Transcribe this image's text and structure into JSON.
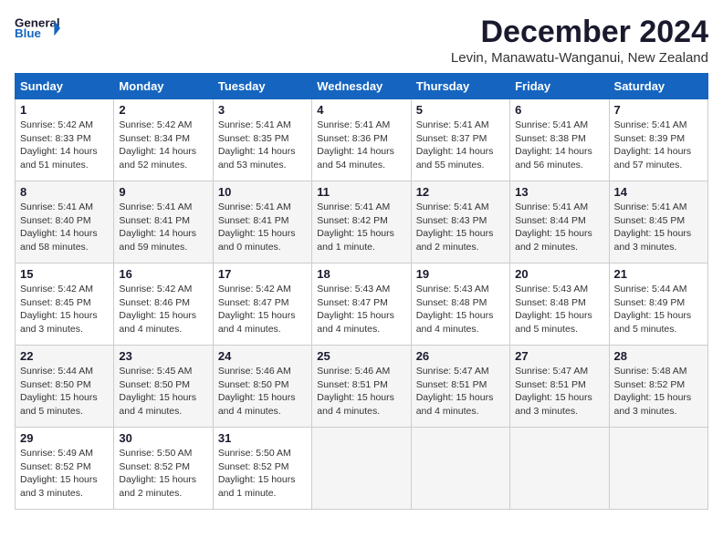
{
  "header": {
    "logo_general": "General",
    "logo_blue": "Blue",
    "month_title": "December 2024",
    "location": "Levin, Manawatu-Wanganui, New Zealand"
  },
  "weekdays": [
    "Sunday",
    "Monday",
    "Tuesday",
    "Wednesday",
    "Thursday",
    "Friday",
    "Saturday"
  ],
  "weeks": [
    [
      {
        "day": 1,
        "sunrise": "5:42 AM",
        "sunset": "8:33 PM",
        "daylight": "14 hours and 51 minutes."
      },
      {
        "day": 2,
        "sunrise": "5:42 AM",
        "sunset": "8:34 PM",
        "daylight": "14 hours and 52 minutes."
      },
      {
        "day": 3,
        "sunrise": "5:41 AM",
        "sunset": "8:35 PM",
        "daylight": "14 hours and 53 minutes."
      },
      {
        "day": 4,
        "sunrise": "5:41 AM",
        "sunset": "8:36 PM",
        "daylight": "14 hours and 54 minutes."
      },
      {
        "day": 5,
        "sunrise": "5:41 AM",
        "sunset": "8:37 PM",
        "daylight": "14 hours and 55 minutes."
      },
      {
        "day": 6,
        "sunrise": "5:41 AM",
        "sunset": "8:38 PM",
        "daylight": "14 hours and 56 minutes."
      },
      {
        "day": 7,
        "sunrise": "5:41 AM",
        "sunset": "8:39 PM",
        "daylight": "14 hours and 57 minutes."
      }
    ],
    [
      {
        "day": 8,
        "sunrise": "5:41 AM",
        "sunset": "8:40 PM",
        "daylight": "14 hours and 58 minutes."
      },
      {
        "day": 9,
        "sunrise": "5:41 AM",
        "sunset": "8:41 PM",
        "daylight": "14 hours and 59 minutes."
      },
      {
        "day": 10,
        "sunrise": "5:41 AM",
        "sunset": "8:41 PM",
        "daylight": "15 hours and 0 minutes."
      },
      {
        "day": 11,
        "sunrise": "5:41 AM",
        "sunset": "8:42 PM",
        "daylight": "15 hours and 1 minute."
      },
      {
        "day": 12,
        "sunrise": "5:41 AM",
        "sunset": "8:43 PM",
        "daylight": "15 hours and 2 minutes."
      },
      {
        "day": 13,
        "sunrise": "5:41 AM",
        "sunset": "8:44 PM",
        "daylight": "15 hours and 2 minutes."
      },
      {
        "day": 14,
        "sunrise": "5:41 AM",
        "sunset": "8:45 PM",
        "daylight": "15 hours and 3 minutes."
      }
    ],
    [
      {
        "day": 15,
        "sunrise": "5:42 AM",
        "sunset": "8:45 PM",
        "daylight": "15 hours and 3 minutes."
      },
      {
        "day": 16,
        "sunrise": "5:42 AM",
        "sunset": "8:46 PM",
        "daylight": "15 hours and 4 minutes."
      },
      {
        "day": 17,
        "sunrise": "5:42 AM",
        "sunset": "8:47 PM",
        "daylight": "15 hours and 4 minutes."
      },
      {
        "day": 18,
        "sunrise": "5:43 AM",
        "sunset": "8:47 PM",
        "daylight": "15 hours and 4 minutes."
      },
      {
        "day": 19,
        "sunrise": "5:43 AM",
        "sunset": "8:48 PM",
        "daylight": "15 hours and 4 minutes."
      },
      {
        "day": 20,
        "sunrise": "5:43 AM",
        "sunset": "8:48 PM",
        "daylight": "15 hours and 5 minutes."
      },
      {
        "day": 21,
        "sunrise": "5:44 AM",
        "sunset": "8:49 PM",
        "daylight": "15 hours and 5 minutes."
      }
    ],
    [
      {
        "day": 22,
        "sunrise": "5:44 AM",
        "sunset": "8:50 PM",
        "daylight": "15 hours and 5 minutes."
      },
      {
        "day": 23,
        "sunrise": "5:45 AM",
        "sunset": "8:50 PM",
        "daylight": "15 hours and 4 minutes."
      },
      {
        "day": 24,
        "sunrise": "5:46 AM",
        "sunset": "8:50 PM",
        "daylight": "15 hours and 4 minutes."
      },
      {
        "day": 25,
        "sunrise": "5:46 AM",
        "sunset": "8:51 PM",
        "daylight": "15 hours and 4 minutes."
      },
      {
        "day": 26,
        "sunrise": "5:47 AM",
        "sunset": "8:51 PM",
        "daylight": "15 hours and 4 minutes."
      },
      {
        "day": 27,
        "sunrise": "5:47 AM",
        "sunset": "8:51 PM",
        "daylight": "15 hours and 3 minutes."
      },
      {
        "day": 28,
        "sunrise": "5:48 AM",
        "sunset": "8:52 PM",
        "daylight": "15 hours and 3 minutes."
      }
    ],
    [
      {
        "day": 29,
        "sunrise": "5:49 AM",
        "sunset": "8:52 PM",
        "daylight": "15 hours and 3 minutes."
      },
      {
        "day": 30,
        "sunrise": "5:50 AM",
        "sunset": "8:52 PM",
        "daylight": "15 hours and 2 minutes."
      },
      {
        "day": 31,
        "sunrise": "5:50 AM",
        "sunset": "8:52 PM",
        "daylight": "15 hours and 1 minute."
      },
      null,
      null,
      null,
      null
    ]
  ]
}
